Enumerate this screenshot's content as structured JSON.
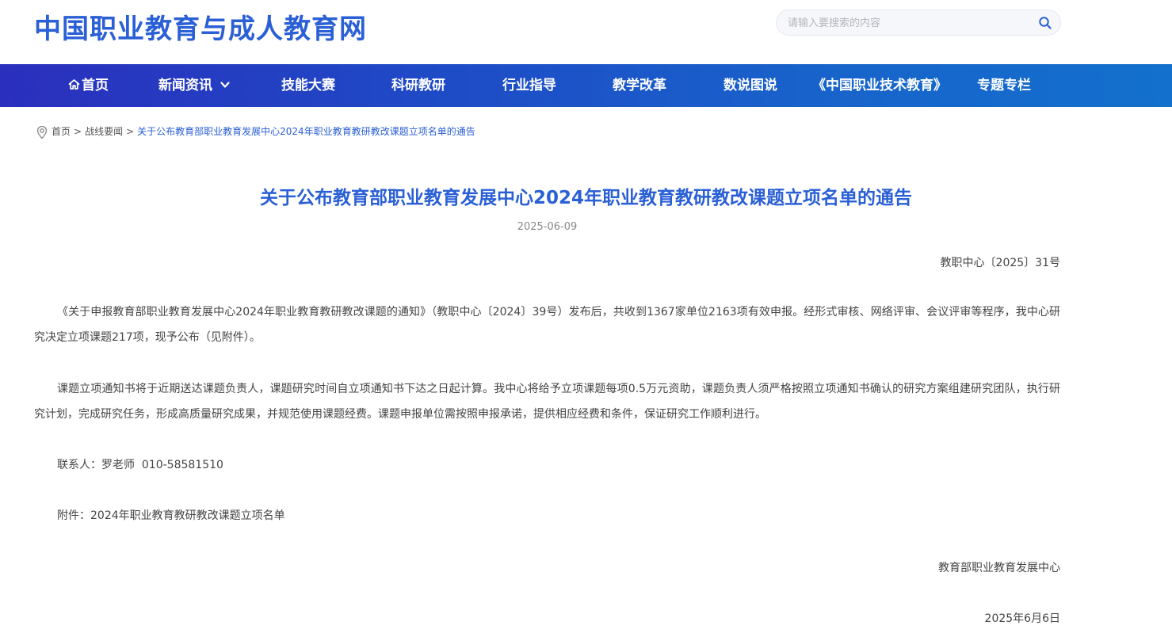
{
  "site": {
    "title": "中国职业教育与成人教育网"
  },
  "search": {
    "placeholder": "请输入要搜索的内容",
    "icon": "search-icon"
  },
  "nav": {
    "items": [
      {
        "label": "首页",
        "icon": "home-icon"
      },
      {
        "label": "新闻资讯",
        "icon": "chevron-down-icon"
      },
      {
        "label": "技能大赛"
      },
      {
        "label": "科研教研"
      },
      {
        "label": "行业指导"
      },
      {
        "label": "教学改革"
      },
      {
        "label": "数说图说"
      },
      {
        "label": "《中国职业技术教育》"
      },
      {
        "label": "专题专栏"
      }
    ]
  },
  "breadcrumb": {
    "icon": "location-pin-icon",
    "separator": ">",
    "items": [
      "首页",
      "战线要闻",
      "关于公布教育部职业教育发展中心2024年职业教育教研教改课题立项名单的通告"
    ]
  },
  "article": {
    "title": "关于公布教育部职业教育发展中心2024年职业教育教研教改课题立项名单的通告",
    "date": "2025-06-09",
    "doc_number": "教职中心〔2025〕31号",
    "paragraphs": [
      "《关于申报教育部职业教育发展中心2024年职业教育教研教改课题的通知》（教职中心〔2024〕39号）发布后，共收到1367家单位2163项有效申报。经形式审核、网络评审、会议评审等程序，我中心研究决定立项课题217项，现予公布（见附件）。",
      "课题立项通知书将于近期送达课题负责人，课题研究时间自立项通知书下达之日起计算。我中心将给予立项课题每项0.5万元资助，课题负责人须严格按照立项通知书确认的研究方案组建研究团队，执行研究计划，完成研究任务，形成高质量研究成果，并规范使用课题经费。课题申报单位需按照申报承诺，提供相应经费和条件，保证研究工作顺利进行。",
      "联系人：罗老师  010-58581510",
      "附件：2024年职业教育教研教改课题立项名单"
    ],
    "signature": "教育部职业教育发展中心",
    "sign_date": "2025年6月6日"
  },
  "colors": {
    "brand": "#2a5fd6",
    "nav_start": "#2b2fbd",
    "nav_end": "#1370cc"
  }
}
